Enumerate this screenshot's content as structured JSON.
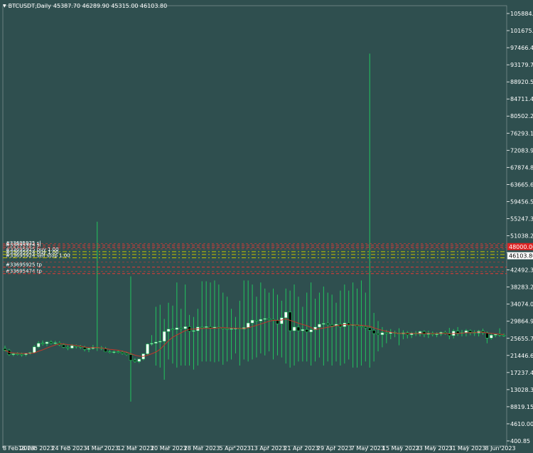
{
  "header": {
    "symbol_timeframe": "BTCUSDT,Daily",
    "ohlc": "45387.70 46289.90 45315.00 46103.80",
    "menu_arrow": "dropdown-arrow-icon"
  },
  "colors": {
    "background": "#2f4f4f",
    "grid": "#ffffff",
    "bull": "#ffffff",
    "bear": "#000000",
    "wick": "#22c55e",
    "ma": "#c0392b",
    "order_sl": "#e53935",
    "order_open": "#c0c000",
    "order_tp": "#7cb342",
    "price_tag_current": "#ffffff",
    "price_tag_sl": "#dd2222"
  },
  "price_axis": {
    "labels": [
      "105884.20",
      "101675.55",
      "97466.40",
      "93179.70",
      "88920.55",
      "84711.40",
      "80502.25",
      "76293.10",
      "72083.95",
      "67874.80",
      "63665.65",
      "59456.50",
      "55247.35",
      "51038.20",
      "46103.80",
      "42492.35",
      "38283.20",
      "34074.05",
      "29864.90",
      "25655.75",
      "21446.60",
      "17237.45",
      "13028.30",
      "8819.15",
      "4610.00",
      "400.85"
    ],
    "current_price": "46103.80",
    "sl_price_tag": "48000.00"
  },
  "time_axis": {
    "labels": [
      "8 Feb 2023",
      "16 Feb 2023",
      "24 Feb 2023",
      "4 Mar 2023",
      "12 Mar 2023",
      "20 Mar 2023",
      "28 Mar 2023",
      "5 Apr 2023",
      "13 Apr 2023",
      "21 Apr 2023",
      "29 Apr 2023",
      "7 May 2023",
      "15 May 2023",
      "23 May 2023",
      "31 May 2023",
      "8 Jun 2023"
    ]
  },
  "orders": [
    {
      "text": "#33695925 sl",
      "price": 48700,
      "kind": "sl"
    },
    {
      "text": "#33695924 sl",
      "price": 48200,
      "kind": "sl"
    },
    {
      "text": "#33695925 buy 1.00",
      "price": 47100,
      "kind": "open"
    },
    {
      "text": "#33695924 buy 1.00",
      "price": 46400,
      "kind": "open"
    },
    {
      "text": "#33695924 sell stop 1.00",
      "price": 45600,
      "kind": "open"
    },
    {
      "text": "#33695925 tp",
      "price": 43300,
      "kind": "tp"
    },
    {
      "text": "#33695474 tp",
      "price": 41700,
      "kind": "tp"
    }
  ],
  "chart_data": {
    "type": "candlestick",
    "ylim": [
      400.85,
      110000
    ],
    "candles": [
      {
        "o": 23200,
        "h": 23900,
        "l": 22500,
        "c": 22800
      },
      {
        "o": 22800,
        "h": 23100,
        "l": 21400,
        "c": 21700
      },
      {
        "o": 21700,
        "h": 22200,
        "l": 21300,
        "c": 21900
      },
      {
        "o": 21900,
        "h": 22300,
        "l": 21500,
        "c": 21800
      },
      {
        "o": 21800,
        "h": 22200,
        "l": 21200,
        "c": 21700
      },
      {
        "o": 21700,
        "h": 22100,
        "l": 21300,
        "c": 22000
      },
      {
        "o": 22000,
        "h": 22400,
        "l": 21700,
        "c": 22200
      },
      {
        "o": 22200,
        "h": 24000,
        "l": 22000,
        "c": 23600
      },
      {
        "o": 23600,
        "h": 25000,
        "l": 23300,
        "c": 24500
      },
      {
        "o": 24500,
        "h": 25200,
        "l": 23900,
        "c": 24400
      },
      {
        "o": 24400,
        "h": 25000,
        "l": 23800,
        "c": 24800
      },
      {
        "o": 24800,
        "h": 25200,
        "l": 24200,
        "c": 24500
      },
      {
        "o": 24500,
        "h": 25100,
        "l": 24000,
        "c": 24600
      },
      {
        "o": 24600,
        "h": 25000,
        "l": 23800,
        "c": 24100
      },
      {
        "o": 24100,
        "h": 24500,
        "l": 23300,
        "c": 23500
      },
      {
        "o": 23500,
        "h": 24000,
        "l": 22800,
        "c": 23300
      },
      {
        "o": 23300,
        "h": 24300,
        "l": 23100,
        "c": 23900
      },
      {
        "o": 23900,
        "h": 24200,
        "l": 23200,
        "c": 23700
      },
      {
        "o": 23700,
        "h": 24100,
        "l": 23100,
        "c": 23500
      },
      {
        "o": 23500,
        "h": 23900,
        "l": 22500,
        "c": 23000
      },
      {
        "o": 23000,
        "h": 23400,
        "l": 22300,
        "c": 23200
      },
      {
        "o": 23200,
        "h": 24100,
        "l": 22900,
        "c": 23500
      },
      {
        "o": 23500,
        "h": 54500,
        "l": 22600,
        "c": 23400
      },
      {
        "o": 23400,
        "h": 23800,
        "l": 22800,
        "c": 23200
      },
      {
        "o": 23200,
        "h": 23600,
        "l": 22300,
        "c": 22400
      },
      {
        "o": 22400,
        "h": 22800,
        "l": 22000,
        "c": 22300
      },
      {
        "o": 22300,
        "h": 22700,
        "l": 21900,
        "c": 22400
      },
      {
        "o": 22400,
        "h": 22800,
        "l": 22000,
        "c": 22300
      },
      {
        "o": 22300,
        "h": 22700,
        "l": 21700,
        "c": 22000
      },
      {
        "o": 22000,
        "h": 22400,
        "l": 21400,
        "c": 21700
      },
      {
        "o": 21700,
        "h": 41000,
        "l": 10100,
        "c": 20300
      },
      {
        "o": 20300,
        "h": 20800,
        "l": 19700,
        "c": 20000
      },
      {
        "o": 20000,
        "h": 20600,
        "l": 19600,
        "c": 20600
      },
      {
        "o": 20600,
        "h": 22000,
        "l": 20300,
        "c": 21900
      },
      {
        "o": 21900,
        "h": 24500,
        "l": 21500,
        "c": 24300
      },
      {
        "o": 24300,
        "h": 26500,
        "l": 23900,
        "c": 24500
      },
      {
        "o": 24500,
        "h": 33500,
        "l": 19000,
        "c": 24800
      },
      {
        "o": 24800,
        "h": 34000,
        "l": 18500,
        "c": 25000
      },
      {
        "o": 25000,
        "h": 30500,
        "l": 15500,
        "c": 27400
      },
      {
        "o": 27400,
        "h": 34500,
        "l": 20500,
        "c": 28000
      },
      {
        "o": 28000,
        "h": 33800,
        "l": 19500,
        "c": 27900
      },
      {
        "o": 27900,
        "h": 39500,
        "l": 18500,
        "c": 28300
      },
      {
        "o": 28300,
        "h": 33000,
        "l": 19000,
        "c": 28100
      },
      {
        "o": 28100,
        "h": 39000,
        "l": 19000,
        "c": 28600
      },
      {
        "o": 28600,
        "h": 31500,
        "l": 19000,
        "c": 27500
      },
      {
        "o": 27500,
        "h": 31000,
        "l": 18000,
        "c": 27600
      },
      {
        "o": 27600,
        "h": 33000,
        "l": 19000,
        "c": 28500
      },
      {
        "o": 28500,
        "h": 39800,
        "l": 20000,
        "c": 28400
      },
      {
        "o": 28400,
        "h": 39800,
        "l": 20000,
        "c": 28600
      },
      {
        "o": 28600,
        "h": 39500,
        "l": 20000,
        "c": 28300
      },
      {
        "o": 28300,
        "h": 40000,
        "l": 19800,
        "c": 28500
      },
      {
        "o": 28500,
        "h": 39000,
        "l": 20000,
        "c": 28300
      },
      {
        "o": 28300,
        "h": 37000,
        "l": 19200,
        "c": 28100
      },
      {
        "o": 28100,
        "h": 36000,
        "l": 20000,
        "c": 28000
      },
      {
        "o": 28000,
        "h": 33000,
        "l": 20500,
        "c": 28100
      },
      {
        "o": 28100,
        "h": 31000,
        "l": 22000,
        "c": 28200
      },
      {
        "o": 28200,
        "h": 35000,
        "l": 19000,
        "c": 28000
      },
      {
        "o": 28000,
        "h": 40000,
        "l": 20500,
        "c": 28400
      },
      {
        "o": 28400,
        "h": 40000,
        "l": 20000,
        "c": 29500
      },
      {
        "o": 29500,
        "h": 39000,
        "l": 20500,
        "c": 30200
      },
      {
        "o": 30200,
        "h": 36000,
        "l": 21000,
        "c": 30000
      },
      {
        "o": 30000,
        "h": 39500,
        "l": 22000,
        "c": 30400
      },
      {
        "o": 30400,
        "h": 38000,
        "l": 21500,
        "c": 30600
      },
      {
        "o": 30600,
        "h": 37000,
        "l": 22500,
        "c": 30400
      },
      {
        "o": 30400,
        "h": 38000,
        "l": 20500,
        "c": 30100
      },
      {
        "o": 30100,
        "h": 36500,
        "l": 21500,
        "c": 29300
      },
      {
        "o": 29300,
        "h": 35000,
        "l": 21000,
        "c": 30800
      },
      {
        "o": 30800,
        "h": 38000,
        "l": 19500,
        "c": 32200
      },
      {
        "o": 32200,
        "h": 37500,
        "l": 18500,
        "c": 27600
      },
      {
        "o": 27600,
        "h": 39000,
        "l": 19000,
        "c": 28500
      },
      {
        "o": 28500,
        "h": 36000,
        "l": 20000,
        "c": 27600
      },
      {
        "o": 27600,
        "h": 33500,
        "l": 20000,
        "c": 27900
      },
      {
        "o": 27900,
        "h": 37000,
        "l": 20000,
        "c": 27300
      },
      {
        "o": 27300,
        "h": 39500,
        "l": 19000,
        "c": 27800
      },
      {
        "o": 27800,
        "h": 35500,
        "l": 20000,
        "c": 28500
      },
      {
        "o": 28500,
        "h": 37000,
        "l": 21000,
        "c": 29200
      },
      {
        "o": 29200,
        "h": 38500,
        "l": 19000,
        "c": 29400
      },
      {
        "o": 29400,
        "h": 37000,
        "l": 20000,
        "c": 29100
      },
      {
        "o": 29100,
        "h": 36500,
        "l": 19000,
        "c": 28800
      },
      {
        "o": 28800,
        "h": 34500,
        "l": 20000,
        "c": 29200
      },
      {
        "o": 29200,
        "h": 37500,
        "l": 19000,
        "c": 28600
      },
      {
        "o": 28600,
        "h": 39000,
        "l": 19500,
        "c": 29500
      },
      {
        "o": 29500,
        "h": 37500,
        "l": 20500,
        "c": 28900
      },
      {
        "o": 28900,
        "h": 39500,
        "l": 18500,
        "c": 29100
      },
      {
        "o": 29100,
        "h": 38000,
        "l": 18500,
        "c": 28700
      },
      {
        "o": 28700,
        "h": 40000,
        "l": 19000,
        "c": 28600
      },
      {
        "o": 28600,
        "h": 37000,
        "l": 20000,
        "c": 28300
      },
      {
        "o": 28300,
        "h": 96000,
        "l": 18500,
        "c": 27700
      },
      {
        "o": 27700,
        "h": 32000,
        "l": 20000,
        "c": 26900
      },
      {
        "o": 26900,
        "h": 30000,
        "l": 22500,
        "c": 26600
      },
      {
        "o": 26600,
        "h": 28500,
        "l": 23500,
        "c": 27100
      },
      {
        "o": 27100,
        "h": 27800,
        "l": 24500,
        "c": 26900
      },
      {
        "o": 26900,
        "h": 28000,
        "l": 25500,
        "c": 27200
      },
      {
        "o": 27200,
        "h": 27600,
        "l": 26000,
        "c": 27000
      },
      {
        "o": 27000,
        "h": 28200,
        "l": 24000,
        "c": 26800
      },
      {
        "o": 26800,
        "h": 27700,
        "l": 25500,
        "c": 27100
      },
      {
        "o": 27100,
        "h": 27500,
        "l": 25700,
        "c": 26600
      },
      {
        "o": 26600,
        "h": 27300,
        "l": 25800,
        "c": 27000
      },
      {
        "o": 27000,
        "h": 27500,
        "l": 26300,
        "c": 26800
      },
      {
        "o": 26800,
        "h": 27600,
        "l": 26200,
        "c": 27400
      },
      {
        "o": 27400,
        "h": 27700,
        "l": 26000,
        "c": 26700
      },
      {
        "o": 26700,
        "h": 27600,
        "l": 25800,
        "c": 27000
      },
      {
        "o": 27000,
        "h": 27400,
        "l": 26200,
        "c": 26700
      },
      {
        "o": 26700,
        "h": 27200,
        "l": 26000,
        "c": 26800
      },
      {
        "o": 26800,
        "h": 27400,
        "l": 26300,
        "c": 27200
      },
      {
        "o": 27200,
        "h": 27600,
        "l": 26600,
        "c": 26900
      },
      {
        "o": 26900,
        "h": 28300,
        "l": 25500,
        "c": 26400
      },
      {
        "o": 26400,
        "h": 28000,
        "l": 25700,
        "c": 27500
      },
      {
        "o": 27500,
        "h": 28500,
        "l": 26300,
        "c": 27000
      },
      {
        "o": 27000,
        "h": 27800,
        "l": 26200,
        "c": 27100
      },
      {
        "o": 27100,
        "h": 28000,
        "l": 26200,
        "c": 27600
      },
      {
        "o": 27600,
        "h": 27900,
        "l": 26500,
        "c": 27200
      },
      {
        "o": 27200,
        "h": 27700,
        "l": 26300,
        "c": 27000
      },
      {
        "o": 27000,
        "h": 27800,
        "l": 26200,
        "c": 27500
      },
      {
        "o": 27500,
        "h": 28100,
        "l": 26600,
        "c": 27100
      },
      {
        "o": 27100,
        "h": 27400,
        "l": 24500,
        "c": 25800
      },
      {
        "o": 25800,
        "h": 27000,
        "l": 25400,
        "c": 26500
      },
      {
        "o": 26500,
        "h": 26900,
        "l": 26000,
        "c": 26700
      },
      {
        "o": 26700,
        "h": 28200,
        "l": 26100,
        "c": 26500
      },
      {
        "o": 26500,
        "h": 26900,
        "l": 26100,
        "c": 26400
      }
    ]
  }
}
